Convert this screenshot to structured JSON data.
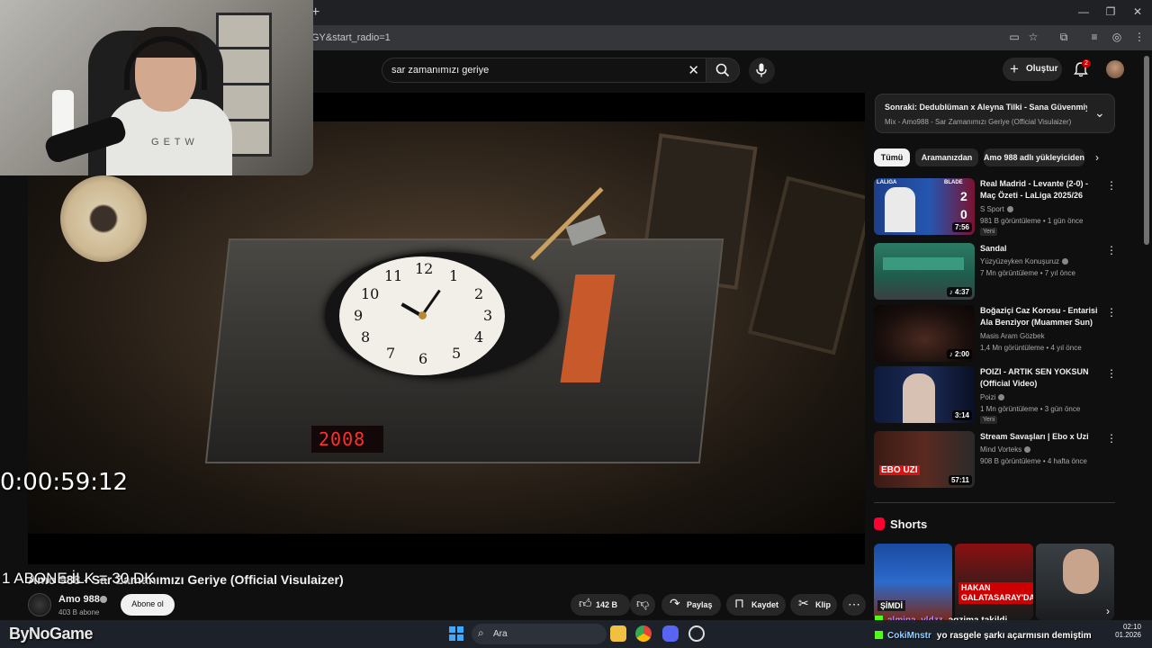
{
  "browser": {
    "new_tab_glyph": "+",
    "url_fragment": "GY&start_radio=1",
    "window_controls": [
      "—",
      "❐",
      "✕"
    ],
    "address_icons": [
      "cast-icon",
      "star-icon",
      "extensions-icon",
      "playlist-icon",
      "profile-icon",
      "kebab-icon"
    ]
  },
  "youtube": {
    "search_query": "sar zamanımızı geriye",
    "create_label": "Oluştur",
    "notification_count": "2"
  },
  "video": {
    "display_year": "2008",
    "clock_numbers": [
      "12",
      "1",
      "2",
      "3",
      "4",
      "5",
      "6",
      "7",
      "8",
      "9",
      "10",
      "11"
    ],
    "title": "Amo 988 - Sar Zamanımızı Geriye (Official Visulaizer)",
    "channel_name": "Amo 988",
    "subscribers": "403 B abone",
    "subscribe_label": "Abone ol",
    "likes": "142 B",
    "share_label": "Paylaş",
    "save_label": "Kaydet",
    "clip_label": "Klip"
  },
  "stream_overlay": {
    "timer": "0:00:59:12",
    "goal_text": "1 ABONE İLK = 30 DK",
    "watermark": "ByNoGame",
    "shirt_text": "G E T W"
  },
  "sidebar": {
    "up_next_title": "Sonraki: Dedublüman x Aleyna Tilki - Sana Güvenmiyorum",
    "up_next_sub": "Mix - Amo988 - Sar Zamanımızı Geriye (Official Visulaizer)",
    "chips": [
      "Tümü",
      "Aramanızdan",
      "Amo 988 adlı yükleyiciden"
    ],
    "recommendations": [
      {
        "title": "Real Madrid - Levante (2-0) - Maç Özeti - LaLiga 2025/26",
        "channel": "S Sport",
        "meta": "981 B görüntüleme • 1 gün önce",
        "duration": "7:56",
        "badge": "Yeni",
        "score_home": "2",
        "score_away": "0",
        "thumb_brand": "BLADE",
        "thumb_league": "LALIGA"
      },
      {
        "title": "Sandal",
        "channel": "Yüzyüzeyken Konuşuruz",
        "meta": "7 Mn görüntüleme • 7 yıl önce",
        "duration": "♪ 4:37",
        "badge": ""
      },
      {
        "title": "Boğaziçi Caz Korosu - Entarisi Ala Benziyor (Muammer Sun)",
        "channel": "Masis Aram Gözbek",
        "meta": "1,4 Mn görüntüleme • 4 yıl önce",
        "duration": "♪ 2:00",
        "badge": ""
      },
      {
        "title": "POIZI - ARTIK SEN YOKSUN (Official Video)",
        "channel": "Poizi",
        "meta": "1 Mn görüntüleme • 3 gün önce",
        "duration": "3:14",
        "badge": "Yeni"
      },
      {
        "title": "Stream Savaşları | Ebo x Uzi",
        "channel": "Mind Vorteks",
        "meta": "908 B görüntüleme • 4 hafta önce",
        "duration": "57:11",
        "badge": "",
        "thumb_text": "EBO UZI"
      }
    ],
    "shorts_title": "Shorts",
    "shorts": [
      {
        "caption": "ŞİMDİ"
      },
      {
        "caption": "HAKAN GALATASARAY'DA"
      },
      {
        "caption": ""
      }
    ]
  },
  "chat": [
    {
      "user": "almina_yldzz",
      "message": "agzima takildi",
      "color": "#b388ff"
    },
    {
      "user": "CokiMnstr",
      "message": "yo rasgele şarkı açarmısın demiştim",
      "color": "#9ad0ff"
    }
  ],
  "taskbar": {
    "search_placeholder": "Ara",
    "time": "02:10",
    "date": "01.2026"
  }
}
